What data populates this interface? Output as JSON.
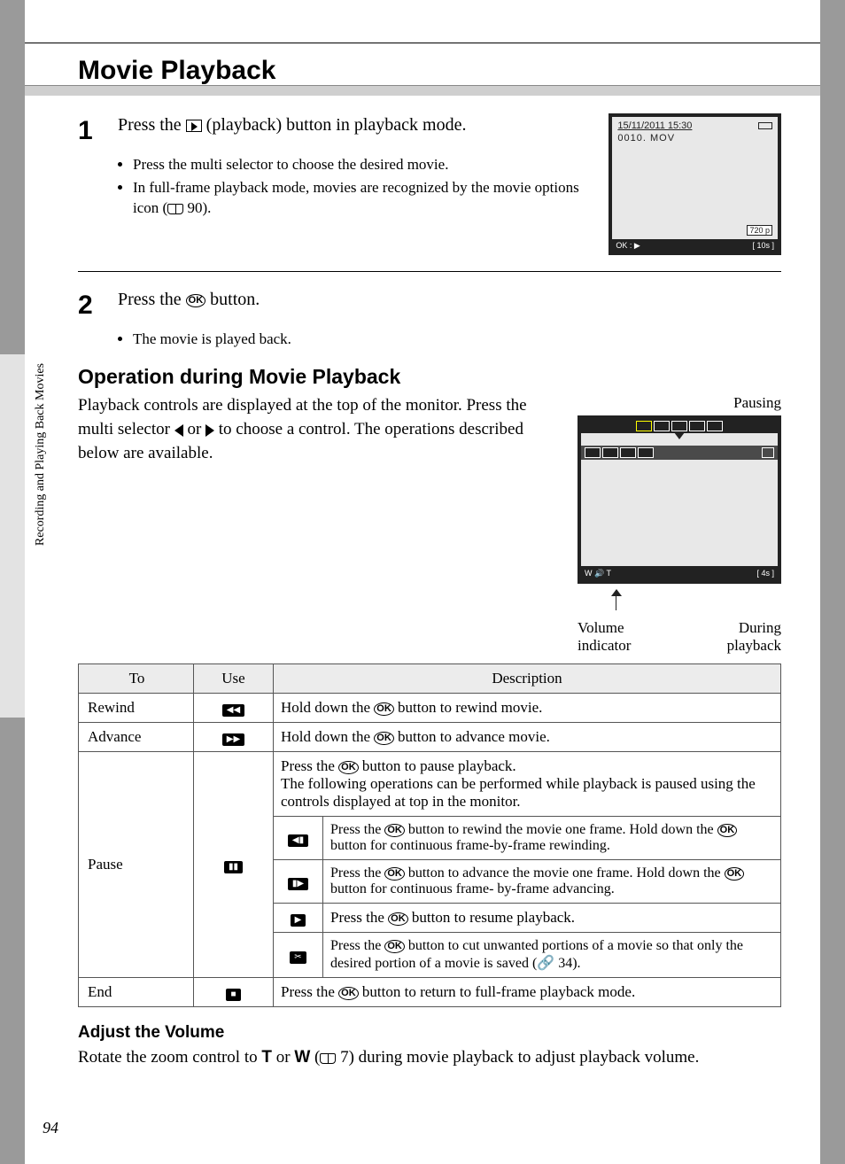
{
  "title": "Movie Playback",
  "side_label": "Recording and Playing Back Movies",
  "page_number": "94",
  "step1": {
    "line1": "Press the ",
    "line2": " (playback) button in playback mode.",
    "b1": "Press the multi selector to choose the desired movie.",
    "b2a": "In full-frame playback mode, movies are recognized by the movie options icon (",
    "b2b": " 90)."
  },
  "screen1": {
    "timestamp": "15/11/2011 15:30",
    "filename": "0010. MOV",
    "resolution": "720 p",
    "bottom_left": "OK : ▶",
    "bottom_right": "10s"
  },
  "step2": {
    "text": "Press the ",
    "text2": " button.",
    "b1": "The movie is played back."
  },
  "operation": {
    "heading": "Operation during Movie Playback",
    "body_a": "Playback controls are displayed at the top of the monitor. Press the multi selector ",
    "body_b": " or ",
    "body_c": " to choose a control. The operations described below are available.",
    "label_pausing": "Pausing",
    "label_volume": "Volume indicator",
    "label_during": "During playback",
    "screen_time": "4s"
  },
  "table": {
    "h_to": "To",
    "h_use": "Use",
    "h_desc": "Description",
    "rewind": {
      "to": "Rewind",
      "desc_a": "Hold down the ",
      "desc_b": " button to rewind movie."
    },
    "advance": {
      "to": "Advance",
      "desc_a": "Hold down the ",
      "desc_b": " button to advance movie."
    },
    "pause": {
      "to": "Pause",
      "intro_a": "Press the ",
      "intro_b": " button to pause playback.",
      "intro_c": "The following operations can be performed while playback is paused using the controls displayed at top in the monitor.",
      "r1_a": "Press the ",
      "r1_b": " button to rewind the movie one frame. Hold down the ",
      "r1_c": " button for continuous frame-by-frame rewinding.",
      "r2_a": "Press the ",
      "r2_b": " button to advance the movie one frame. Hold down the ",
      "r2_c": " button for continuous frame- by-frame advancing.",
      "r3_a": "Press the ",
      "r3_b": " button to resume playback.",
      "r4_a": "Press the ",
      "r4_b": " button to cut unwanted portions of a movie so that only the desired portion of a movie is saved (",
      "r4_c": " 34)."
    },
    "end": {
      "to": "End",
      "desc_a": "Press the ",
      "desc_b": " button to return to full-frame playback mode."
    }
  },
  "adjust": {
    "heading": "Adjust the Volume",
    "body_a": "Rotate the zoom control to ",
    "body_b": " or ",
    "body_c": " (",
    "body_d": " 7) during movie playback to adjust playback volume.",
    "T": "T",
    "W": "W"
  }
}
